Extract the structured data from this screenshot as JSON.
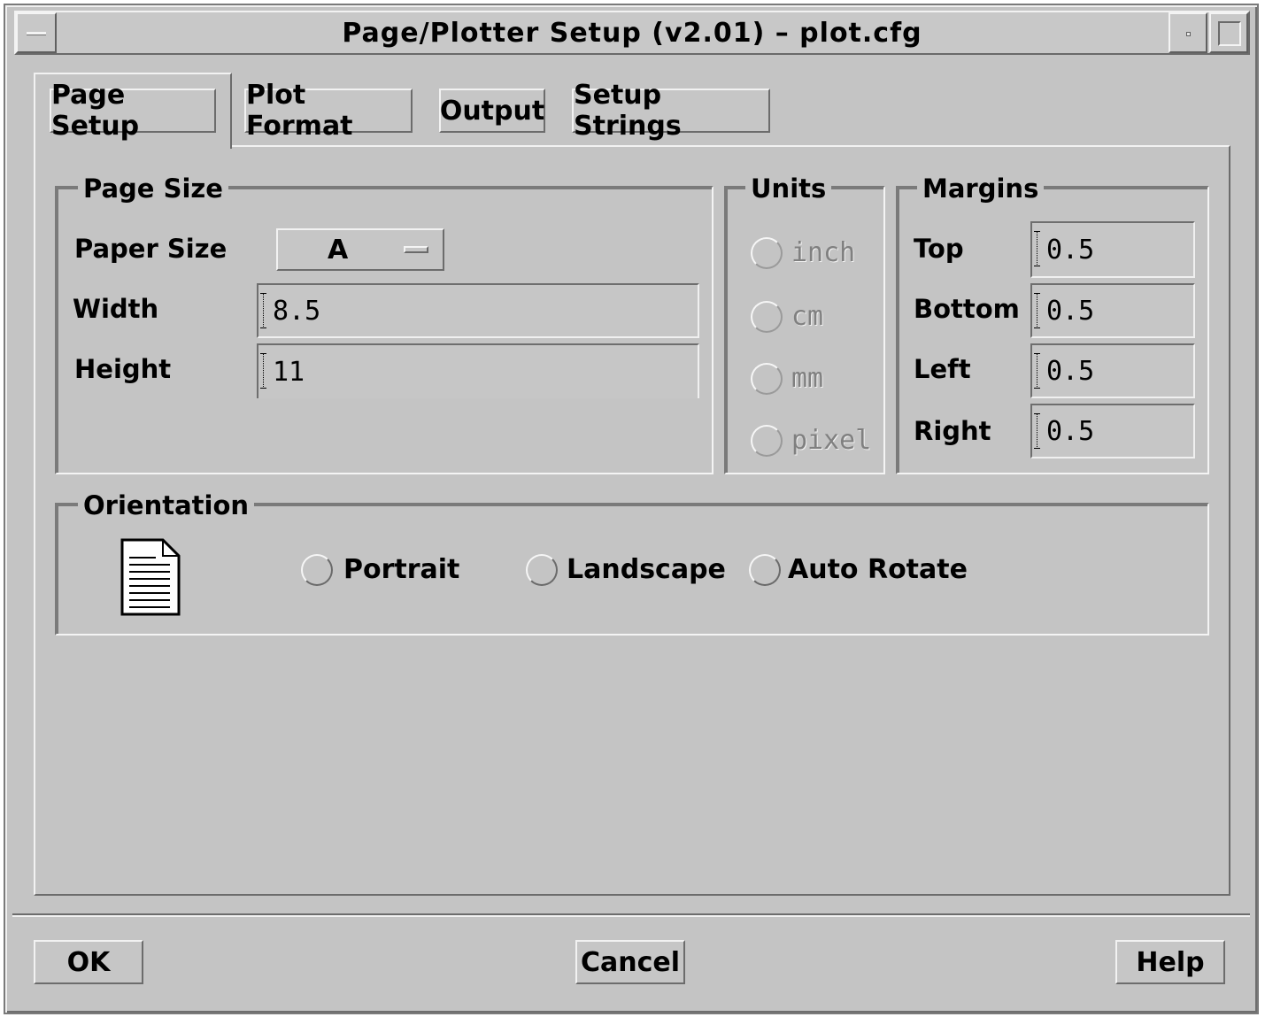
{
  "window": {
    "title": "Page/Plotter Setup  (v2.01) – plot.cfg"
  },
  "tabs": [
    {
      "label": "Page Setup",
      "active": true
    },
    {
      "label": "Plot Format",
      "active": false
    },
    {
      "label": "Output",
      "active": false
    },
    {
      "label": "Setup Strings",
      "active": false
    }
  ],
  "page_size": {
    "legend": "Page Size",
    "paper_size_label": "Paper Size",
    "paper_size_value": "A",
    "width_label": "Width",
    "width_value": "8.5",
    "height_label": "Height",
    "height_value": "11"
  },
  "units": {
    "legend": "Units",
    "options": [
      "inch",
      "cm",
      "mm",
      "pixel"
    ],
    "enabled": false
  },
  "margins": {
    "legend": "Margins",
    "top_label": "Top",
    "top_value": "0.5",
    "bottom_label": "Bottom",
    "bottom_value": "0.5",
    "left_label": "Left",
    "left_value": "0.5",
    "right_label": "Right",
    "right_value": "0.5"
  },
  "orientation": {
    "legend": "Orientation",
    "options": [
      "Portrait",
      "Landscape",
      "Auto Rotate"
    ],
    "icon": "portrait-page-icon"
  },
  "buttons": {
    "ok": "OK",
    "cancel": "Cancel",
    "help": "Help"
  }
}
